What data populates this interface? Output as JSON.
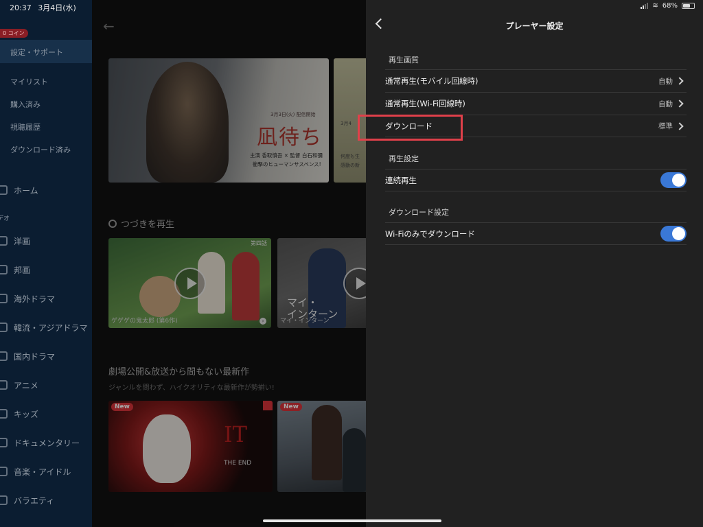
{
  "status": {
    "time": "20:37",
    "date": "3月4日(水)",
    "battery": "68%",
    "battery_level": 0.68
  },
  "sidebar": {
    "coin_badge": "0 コイン",
    "active": "設定・サポート",
    "sub_items": [
      {
        "label": "マイリスト"
      },
      {
        "label": "購入済み"
      },
      {
        "label": "視聴履歴"
      },
      {
        "label": "ダウンロード済み"
      }
    ],
    "home": "ホーム",
    "section": "デオ",
    "genres": [
      {
        "label": "洋画",
        "icon": "globe-icon"
      },
      {
        "label": "邦画",
        "icon": "film-icon"
      },
      {
        "label": "海外ドラマ",
        "icon": "drama-icon"
      },
      {
        "label": "韓流・アジアドラマ",
        "icon": "asia-icon"
      },
      {
        "label": "国内ドラマ",
        "icon": "tv-icon"
      },
      {
        "label": "アニメ",
        "icon": "anime-icon"
      },
      {
        "label": "キッズ",
        "icon": "kids-icon"
      },
      {
        "label": "ドキュメンタリー",
        "icon": "doc-icon"
      },
      {
        "label": "音楽・アイドル",
        "icon": "music-icon"
      },
      {
        "label": "バラエティ",
        "icon": "variety-icon"
      }
    ]
  },
  "main": {
    "banner1": {
      "date": "3月3日(火) 配信開始",
      "title": "凪待ち",
      "credit": "主演 香取慎吾 × 監督 白石和彌",
      "tagline": "衝撃のヒューマンサスペンス!"
    },
    "banner2": {
      "date": "3月4",
      "line1": "何度も生",
      "line2": "感動の新"
    },
    "continue_title": "つづきを再生",
    "continue_items": [
      {
        "caption": "ゲゲゲの鬼太郎 (第6作)",
        "episode": "第四話"
      },
      {
        "caption": "マイ・インターン",
        "overlay": "マイ・\nインターン"
      }
    ],
    "new_title": "劇場公開&放送から間もない最新作",
    "new_subtitle": "ジャンルを問わず、ハイクオリティな最新作が勢揃い!",
    "new_badge": "New",
    "poster1": {
      "title": "IT",
      "subtitle": "THE END"
    }
  },
  "panel": {
    "title": "プレーヤー設定",
    "sections": [
      {
        "heading": "再生画質",
        "rows": [
          {
            "label": "通常再生(モバイル回線時)",
            "value": "自動"
          },
          {
            "label": "通常再生(Wi-Fi回線時)",
            "value": "自動"
          },
          {
            "label": "ダウンロード",
            "value": "標準"
          }
        ]
      },
      {
        "heading": "再生設定",
        "rows": [
          {
            "label": "連続再生",
            "toggle": true
          }
        ]
      },
      {
        "heading": "ダウンロード設定",
        "rows": [
          {
            "label": "Wi-Fiのみでダウンロード",
            "toggle": true
          }
        ]
      }
    ]
  }
}
